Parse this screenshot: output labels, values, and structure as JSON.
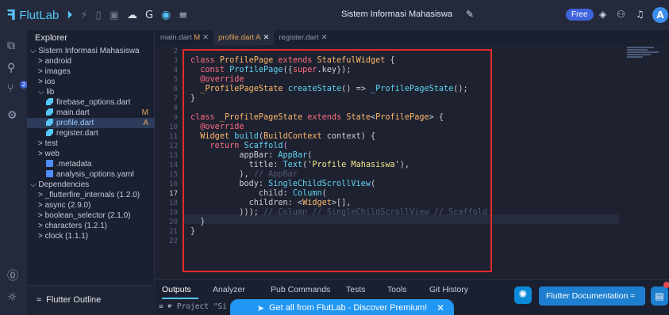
{
  "app": {
    "name": "FlutLab",
    "project_title": "Sistem Informasi Mahasiswa",
    "plan_badge": "Free",
    "avatar_letter": "A"
  },
  "colors": {
    "accent": "#54c5f8",
    "highlight_box": "#e52a2a",
    "promo": "#2196f3"
  },
  "explorer": {
    "title": "Explorer",
    "rows": [
      {
        "label": "Sistem Informasi Mahasiswa",
        "prefix": "⌵ ",
        "indent": 0,
        "icon": ""
      },
      {
        "label": "android",
        "prefix": "> ",
        "indent": 1,
        "icon": ""
      },
      {
        "label": "images",
        "prefix": "> ",
        "indent": 1,
        "icon": ""
      },
      {
        "label": "ios",
        "prefix": "> ",
        "indent": 1,
        "icon": ""
      },
      {
        "label": "lib",
        "prefix": "⌵ ",
        "indent": 1,
        "icon": ""
      },
      {
        "label": "firebase_options.dart",
        "prefix": "",
        "indent": 2,
        "icon": "dart"
      },
      {
        "label": "main.dart",
        "prefix": "",
        "indent": 2,
        "icon": "dart",
        "badge": "M"
      },
      {
        "label": "profile.dart",
        "prefix": "",
        "indent": 2,
        "icon": "dart",
        "badge": "A",
        "selected": true
      },
      {
        "label": "register.dart",
        "prefix": "",
        "indent": 2,
        "icon": "dart"
      },
      {
        "label": "test",
        "prefix": "> ",
        "indent": 1,
        "icon": ""
      },
      {
        "label": "web",
        "prefix": "> ",
        "indent": 1,
        "icon": ""
      },
      {
        "label": ".metadata",
        "prefix": "",
        "indent": 2,
        "icon": "doc"
      },
      {
        "label": "analysis_options.yaml",
        "prefix": "",
        "indent": 2,
        "icon": "doc"
      },
      {
        "label": "Dependencies",
        "prefix": "⌵ ",
        "indent": 0,
        "icon": ""
      },
      {
        "label": "_flutterfire_internals (1.2.0)",
        "prefix": "> ",
        "indent": 1,
        "icon": ""
      },
      {
        "label": "async (2.9.0)",
        "prefix": "> ",
        "indent": 1,
        "icon": ""
      },
      {
        "label": "boolean_selector (2.1.0)",
        "prefix": "> ",
        "indent": 1,
        "icon": ""
      },
      {
        "label": "characters (1.2.1)",
        "prefix": "> ",
        "indent": 1,
        "icon": ""
      },
      {
        "label": "clock (1.1.1)",
        "prefix": "> ",
        "indent": 1,
        "icon": ""
      }
    ],
    "outline_label": "Flutter Outline"
  },
  "tabs": [
    {
      "name": "main.dart",
      "status": "M",
      "active": false
    },
    {
      "name": "profile.dart",
      "status": "A",
      "active": true
    },
    {
      "name": "register.dart",
      "status": "",
      "active": false
    }
  ],
  "code": {
    "current_line": 17,
    "lines": [
      {
        "n": 2,
        "html": ""
      },
      {
        "n": 3,
        "html": "<span class='kw'>class</span> <span class='ty'>ProfilePage</span> <span class='kw'>extends</span> <span class='ty'>StatefulWidget</span> {"
      },
      {
        "n": 4,
        "html": "  <span class='kw'>const</span> <span class='fn'>ProfilePage</span>({<span class='kw'>super</span>.key});"
      },
      {
        "n": 5,
        "html": "  <span class='an'>@override</span>"
      },
      {
        "n": 6,
        "html": "  <span class='ty'>_ProfilePageState</span> <span class='fn'>createState</span>() => <span class='fn'>_ProfilePageState</span>();"
      },
      {
        "n": 7,
        "html": "}"
      },
      {
        "n": 8,
        "html": ""
      },
      {
        "n": 9,
        "html": "<span class='kw'>class</span> <span class='ty'>_ProfilePageState</span> <span class='kw'>extends</span> <span class='ty'>State</span>&lt;<span class='ty'>ProfilePage</span>&gt; {"
      },
      {
        "n": 10,
        "html": "  <span class='an'>@override</span>"
      },
      {
        "n": 11,
        "html": "  <span class='ty'>Widget</span> <span class='fn'>build</span>(<span class='ty'>BuildContext</span> context) {"
      },
      {
        "n": 12,
        "html": "    <span class='kw'>return</span> <span class='fn'>Scaffold</span><span class='pn'>(</span>"
      },
      {
        "n": 13,
        "html": "          appBar: <span class='fn'>AppBar</span>("
      },
      {
        "n": 14,
        "html": "            title: <span class='fn'>Text</span>(<span class='st'>'Profile Mahasiswa'</span>),"
      },
      {
        "n": 15,
        "html": "          ), <span class='cm'>// AppBar</span>"
      },
      {
        "n": 16,
        "html": "          body: <span class='fn'>SingleChildScrollView</span>("
      },
      {
        "n": 17,
        "html": "              child: <span class='fn'>Column</span>("
      },
      {
        "n": 18,
        "html": "            children: &lt;<span class='ty'>Widget</span>&gt;[],"
      },
      {
        "n": 19,
        "html": "          ))); <span class='cm'>// Column // SingleChildScrollView // Scaffold</span>"
      },
      {
        "n": 20,
        "html": "  }"
      },
      {
        "n": 21,
        "html": "}"
      },
      {
        "n": 22,
        "html": ""
      }
    ]
  },
  "panel": {
    "tabs": [
      "Outputs",
      "Analyzer",
      "Pub Commands",
      "Tests",
      "Tools",
      "Git History"
    ],
    "active_tab": "Outputs",
    "terminal_text": "≡ ☛ Project \"Si"
  },
  "promo": {
    "text": "Get all from FlutLab - Discover Premium!",
    "close": "✕"
  },
  "docs_button": "Flutter Documentation ≈"
}
